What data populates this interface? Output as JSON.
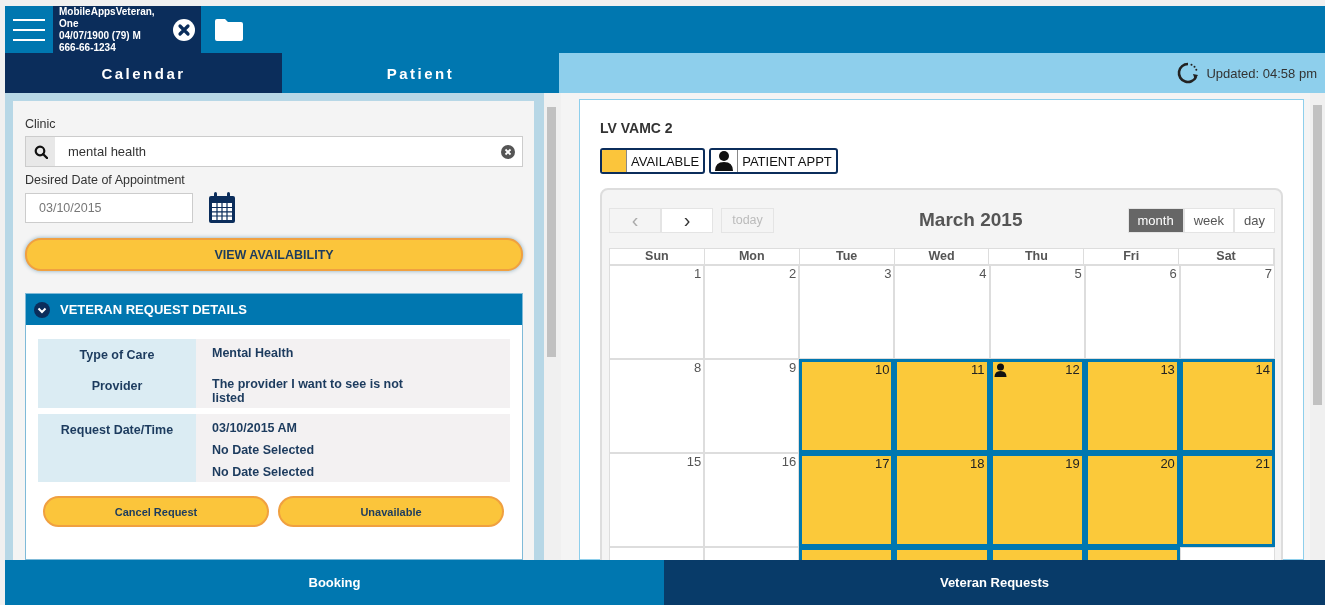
{
  "header": {
    "patient_name": "MobileAppsVeteran, One",
    "patient_dob": "04/07/1900 (79) M",
    "patient_ssn": "666-66-1234"
  },
  "tabs": [
    {
      "label": "Calendar",
      "selected": true
    },
    {
      "label": "Patient",
      "selected": false
    }
  ],
  "status": {
    "updated": "Updated: 04:58 pm"
  },
  "form": {
    "clinic_label": "Clinic",
    "clinic_value": "mental health",
    "date_label": "Desired Date of Appointment",
    "date_value": "03/10/2015",
    "view_button": "VIEW AVAILABILITY"
  },
  "details": {
    "title": "VETERAN REQUEST DETAILS",
    "expanded": true,
    "groups": [
      {
        "rows": [
          {
            "label": "Type of Care",
            "values": [
              "Mental Health"
            ]
          },
          {
            "label": "Provider",
            "values": [
              "The provider I want to see is not listed"
            ]
          }
        ]
      },
      {
        "rows": [
          {
            "label": "Request Date/Time",
            "values": [
              "03/10/2015 AM",
              "No Date Selected",
              "No Date Selected"
            ]
          }
        ]
      }
    ],
    "buttons": [
      "Cancel Request",
      "Unavailable"
    ]
  },
  "calendar": {
    "clinic": "LV VAMC 2",
    "legend": [
      {
        "kind": "available",
        "label": "AVAILABLE"
      },
      {
        "kind": "appointment",
        "label": "PATIENT APPT"
      }
    ],
    "nav_prev": "‹",
    "nav_next": "›",
    "today": "today",
    "title": "March 2015",
    "views": [
      {
        "label": "month",
        "selected": true
      },
      {
        "label": "week",
        "selected": false
      },
      {
        "label": "day",
        "selected": false
      }
    ],
    "weekdays": [
      "Sun",
      "Mon",
      "Tue",
      "Wed",
      "Thu",
      "Fri",
      "Sat"
    ],
    "weeks": [
      [
        {
          "day": "1",
          "available": false,
          "appointment": false
        },
        {
          "day": "2",
          "available": false,
          "appointment": false
        },
        {
          "day": "3",
          "available": false,
          "appointment": false
        },
        {
          "day": "4",
          "available": false,
          "appointment": false
        },
        {
          "day": "5",
          "available": false,
          "appointment": false
        },
        {
          "day": "6",
          "available": false,
          "appointment": false
        },
        {
          "day": "7",
          "available": false,
          "appointment": false
        }
      ],
      [
        {
          "day": "8",
          "available": false,
          "appointment": false
        },
        {
          "day": "9",
          "available": false,
          "appointment": false
        },
        {
          "day": "10",
          "available": true,
          "appointment": false
        },
        {
          "day": "11",
          "available": true,
          "appointment": false
        },
        {
          "day": "12",
          "available": true,
          "appointment": true
        },
        {
          "day": "13",
          "available": true,
          "appointment": false
        },
        {
          "day": "14",
          "available": true,
          "appointment": false
        }
      ],
      [
        {
          "day": "15",
          "available": false,
          "appointment": false
        },
        {
          "day": "16",
          "available": false,
          "appointment": false
        },
        {
          "day": "17",
          "available": true,
          "appointment": false
        },
        {
          "day": "18",
          "available": true,
          "appointment": false
        },
        {
          "day": "19",
          "available": true,
          "appointment": false
        },
        {
          "day": "20",
          "available": true,
          "appointment": false
        },
        {
          "day": "21",
          "available": true,
          "appointment": false
        }
      ],
      [
        {
          "available": false,
          "appointment": false
        },
        {
          "available": false,
          "appointment": false
        },
        {
          "available": true,
          "appointment": false
        },
        {
          "available": true,
          "appointment": false
        },
        {
          "available": true,
          "appointment": false
        },
        {
          "available": true,
          "appointment": false
        },
        {
          "available": false,
          "appointment": false
        }
      ]
    ]
  },
  "bottom_tabs": [
    {
      "label": "Booking",
      "selected": false
    },
    {
      "label": "Veteran Requests",
      "selected": true
    }
  ]
}
